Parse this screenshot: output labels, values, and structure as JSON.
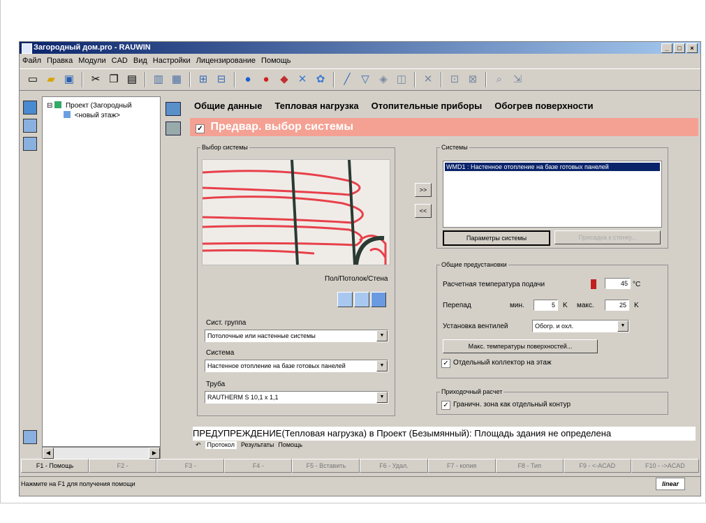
{
  "window": {
    "title": "Загородный дом.pro - RAUWIN",
    "buttons": [
      "_",
      "□",
      "×"
    ]
  },
  "menu": [
    "Файл",
    "Правка",
    "Модули",
    "CAD",
    "Вид",
    "Настройки",
    "Лицензирование",
    "Помощь"
  ],
  "tree": {
    "root": "Проект (Загородный",
    "child": "<новый этаж>"
  },
  "tabs": [
    "Общие данные",
    "Тепловая нагрузка",
    "Отопительные приборы",
    "Обогрев поверхности"
  ],
  "header": {
    "title": "Предвар. выбор системы",
    "checked": "✓"
  },
  "selection": {
    "legend": "Выбор системы",
    "mount_label": "Пол/Потолок/Стена",
    "group_label": "Сист. группа",
    "group_value": "Потолочные или настенные системы",
    "system_label": "Система",
    "system_value": "Настенное отопление на базе готовых панелей",
    "pipe_label": "Труба",
    "pipe_value": "RAUTHERM S 10,1 x 1,1"
  },
  "move": {
    "add": ">>",
    "remove": "<<"
  },
  "systems": {
    "legend": "Системы",
    "item": "WMD1 : Настенное отопление на базе готовых панелей",
    "params_button": "Параметры системы",
    "mount_button": "Присадка к стенку..."
  },
  "presets": {
    "legend": "Общие предустановки",
    "supply_label": "Расчетная температура подачи",
    "supply_value": "45",
    "supply_unit": "°C",
    "diff_label": "Перепад",
    "min_label": "мин.",
    "min_value": "5",
    "min_unit": "K",
    "max_label": "макс.",
    "max_value": "25",
    "max_unit": "K",
    "valve_label": "Установка вентилей",
    "valve_value": "Обогр. и охл.",
    "max_temp_button": "Макс. температуры поверхностей...",
    "separate_collector": "Отдельный коллектор на этаж"
  },
  "approx": {
    "legend": "Приходочный расчет",
    "edge_zone": "Граничн. зона как отдельный контур"
  },
  "warning": "ПРЕДУПРЕЖДЕНИЕ(Тепловая нагрузка) в Проект (Безымянный): Площадь здания не определена",
  "bottom_tabs": [
    "Протокол",
    "Результаты",
    "Помощь"
  ],
  "fkeys": [
    "F1 - Помощь",
    "F2 -",
    "F3 -",
    "F4 -",
    "F5 - Вставить",
    "F6 - Удал.",
    "F7 - копия",
    "F8 - Тип",
    "F9 - <-ACAD",
    "F10 - ->ACAD"
  ],
  "status": "Нажмите на F1 для получения помощи",
  "logo": "linear",
  "colors": {
    "header": "#f4a193",
    "pipe": "#e8404a",
    "rail": "#2b3a33"
  }
}
